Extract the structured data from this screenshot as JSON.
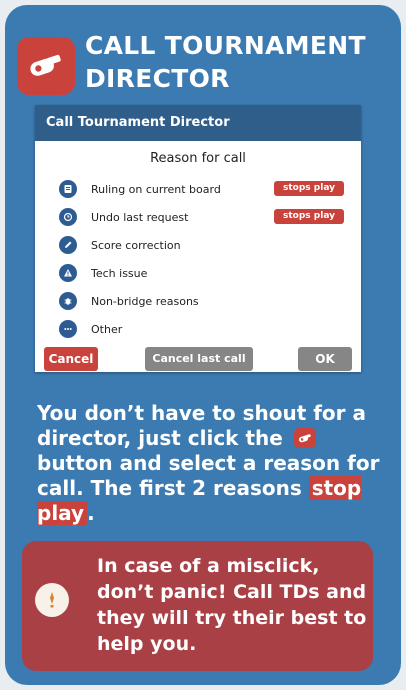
{
  "header": {
    "title": "CALL TOURNAMENT DIRECTOR",
    "logo_icon": "whistle-icon"
  },
  "dialog": {
    "title": "Call Tournament Director",
    "reason_heading": "Reason for call",
    "reasons": [
      {
        "icon": "ruling-icon",
        "label": "Ruling on current board",
        "badge": "stops play"
      },
      {
        "icon": "undo-icon",
        "label": "Undo last request",
        "badge": "stops play"
      },
      {
        "icon": "pencil-icon",
        "label": "Score correction"
      },
      {
        "icon": "warning-icon",
        "label": "Tech issue"
      },
      {
        "icon": "bug-icon",
        "label": "Non-bridge reasons"
      },
      {
        "icon": "more-icon",
        "label": "Other"
      }
    ],
    "buttons": {
      "cancel": "Cancel",
      "cancel_last": "Cancel last call",
      "ok": "OK"
    }
  },
  "instructions": {
    "part1": "You don’t have to shout for a director, just click the",
    "part2": "button and  select a reason for call. The first 2 reasons",
    "highlight": "stop play",
    "end": "."
  },
  "tip": {
    "icon": "lightbulb-icon",
    "text": "In case of a misclick, don’t panic! Call TDs and they will try their best to help you."
  },
  "colors": {
    "background": "#3c7bb1",
    "accent_red": "#c9433c",
    "dialog_header": "#305e8b",
    "tip_box": "#a84045",
    "grey_button": "#868686"
  }
}
